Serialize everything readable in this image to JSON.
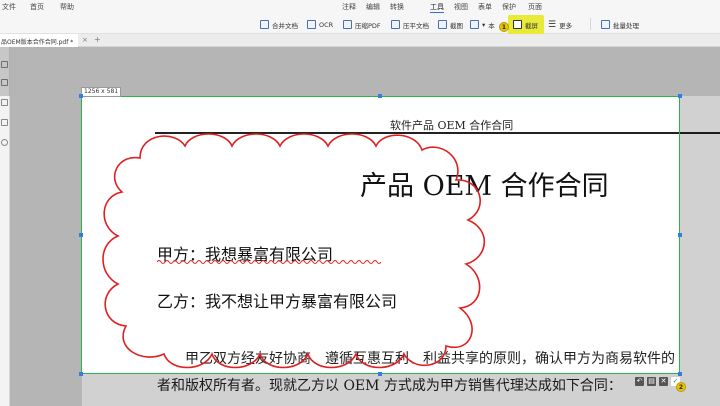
{
  "menubar": {
    "left_items": [
      "文件",
      "首页",
      "帮助"
    ],
    "tabs": [
      "注释",
      "编辑",
      "转换",
      "工具",
      "视图",
      "表单",
      "保护",
      "页面"
    ],
    "active_tab": "工具"
  },
  "ribbon": {
    "buttons": {
      "merge": "合并文档",
      "ocr": "OCR",
      "compress": "压缩PDF",
      "compress_file": "压平文档",
      "crop": "截图",
      "more_truncated": "本",
      "screenshot": "截屏",
      "more": "更多",
      "batch": "批量处理"
    },
    "step_badges": [
      "1",
      "2"
    ]
  },
  "doc_tab": {
    "title": "品OEM版本合作合同.pdf *",
    "close": "×",
    "add": "+"
  },
  "selection": {
    "size_label": "1256 x 581"
  },
  "document": {
    "header": "软件产品 OEM 合作合同",
    "title": "产品 OEM 合作合同",
    "party_a": "甲方：我想暴富有限公司",
    "party_b": "乙方：我不想让甲方暴富有限公司",
    "para_line1": "甲乙双方经友好协商、遵循互惠互利、利益共享的原则，确认甲方为商易软件的",
    "para_line2": "者和版权所有者。现就乙方以 OEM 方式成为甲方销售代理达成如下合同："
  },
  "colors": {
    "highlight": "#e8ea3a",
    "selection_border": "#2fb24b",
    "cloud_annotation": "#e02020",
    "handle": "#2f7fe0"
  }
}
